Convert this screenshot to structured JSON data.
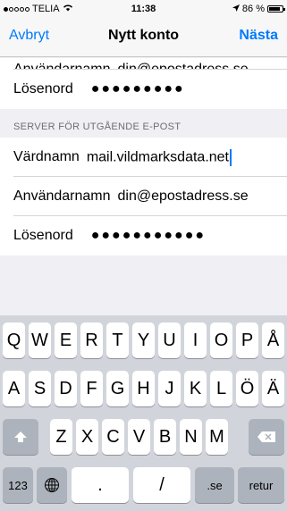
{
  "status_bar": {
    "carrier": "TELIA",
    "time": "11:38",
    "battery_percent": "86 %",
    "battery_level": 0.86,
    "signal_bars_filled": 1,
    "signal_bars_total": 5
  },
  "nav": {
    "cancel_label": "Avbryt",
    "title": "Nytt konto",
    "next_label": "Nästa"
  },
  "incoming": {
    "username_label": "Användarnamn",
    "username_value": "din@epostadress.se",
    "password_label": "Lösenord",
    "password_value": "●●●●●●●●●"
  },
  "outgoing": {
    "section_header": "SERVER FÖR UTGÅENDE E-POST",
    "host_label": "Värdnamn",
    "host_value": "mail.vildmarksdata.net",
    "username_label": "Användarnamn",
    "username_value": "din@epostadress.se",
    "password_label": "Lösenord",
    "password_value": "●●●●●●●●●●●"
  },
  "keyboard": {
    "row1": [
      "Q",
      "W",
      "E",
      "R",
      "T",
      "Y",
      "U",
      "I",
      "O",
      "P",
      "Å"
    ],
    "row2": [
      "A",
      "S",
      "D",
      "F",
      "G",
      "H",
      "J",
      "K",
      "L",
      "Ö",
      "Ä"
    ],
    "row3": [
      "Z",
      "X",
      "C",
      "V",
      "B",
      "N",
      "M"
    ],
    "numbers_label": "123",
    "dot_label": ".",
    "slash_label": "/",
    "se_label": ".se",
    "return_label": "retur"
  },
  "colors": {
    "accent": "#007aff",
    "background": "#efeff4",
    "keyboard_bg": "#d1d5db"
  }
}
